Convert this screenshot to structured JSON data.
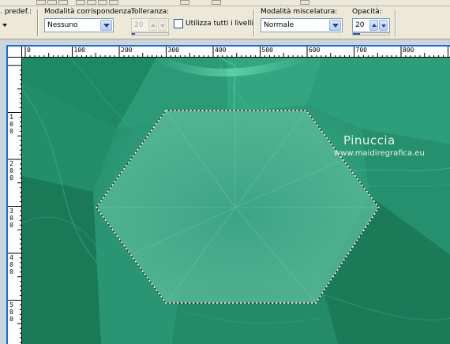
{
  "toolbar": {
    "preset_label": ". predef.:",
    "match_mode_label": "Modalità corrispondenza:",
    "match_mode_value": "Nessuno",
    "tolerance_label": "Tolleranza:",
    "tolerance_value": "20",
    "sample_merged_label": "Utilizza tutti i livelli",
    "sample_merged_checked": false,
    "blend_mode_label": "Modalità miscelatura:",
    "blend_mode_value": "Normale",
    "opacity_label": "Opacità:",
    "opacity_value": "20",
    "opacity_fraction": 0.2
  },
  "ruler": {
    "horizontal_ticks": [
      "0",
      "100",
      "200",
      "300",
      "400",
      "500",
      "600",
      "700",
      "800"
    ],
    "vertical_ticks": [
      "1 0 0",
      "2 0 0",
      "3 0 0",
      "4 0 0",
      "5 0 0"
    ]
  },
  "watermark": {
    "title": "Pinuccia",
    "url": "www.maidiregrafica.eu"
  },
  "colors": {
    "canvas_green": "#2d9a77",
    "selection": "#ffffff",
    "window_border": "#1d6bd6"
  }
}
